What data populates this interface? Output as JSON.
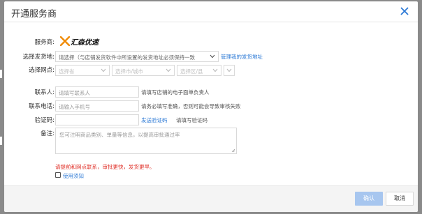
{
  "dialog": {
    "title": "开通服务商"
  },
  "form": {
    "provider_label": "服务商:",
    "provider_logo_text": "汇森优速",
    "ship_address_label": "选择发货地:",
    "ship_address_value": "请选择（与店铺发货软件中所设置的发货地址必须保持一致",
    "manage_address_link": "管理我的发货地址",
    "branch_label": "选择网点:",
    "branch_province": "选择省",
    "branch_city": "选择市/城市",
    "branch_district": "选择区/县",
    "branch_extra": "",
    "contact_label": "联系人:",
    "contact_placeholder": "请填写联系人",
    "contact_hint": "请填写店铺的电子面单负责人",
    "phone_label": "联系电话:",
    "phone_placeholder": "请输入手机号",
    "phone_hint": "请务必填写准确，否则可能会导致审核失败",
    "code_label": "验证码:",
    "code_value": "",
    "send_code_link": "发送验证码",
    "code_hint": "请填写验证码",
    "remark_label": "备注:",
    "remark_placeholder": "您可注明商品类别、单量等信息，以提高审批通过率",
    "warning_text": "请提前和网点联系，审批更快，发货更早。",
    "terms_link": "使用须知"
  },
  "footer": {
    "confirm_label": "确认",
    "cancel_label": "取消"
  },
  "colors": {
    "accent": "#2d7ad6",
    "warning": "#e0322a",
    "primary_disabled": "#a7c6ef"
  },
  "icons": {
    "close": "close-icon",
    "dropdown": "chevron-down-icon",
    "logo": "huisen-logo-icon"
  }
}
